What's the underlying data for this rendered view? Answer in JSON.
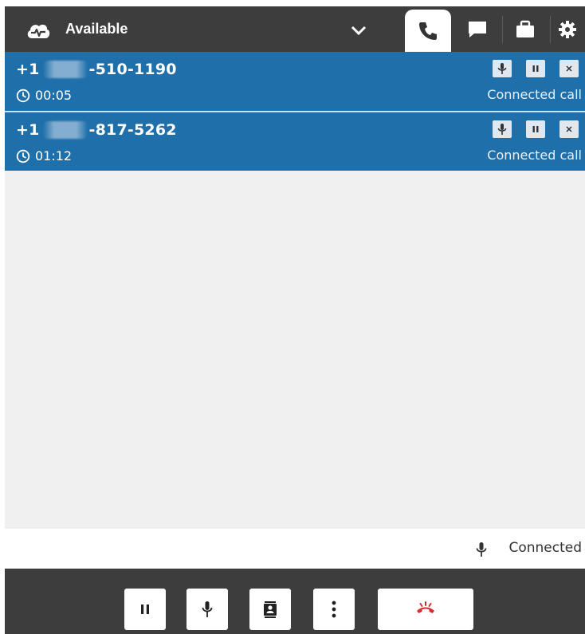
{
  "header": {
    "status_label": "Available",
    "icons": [
      "cloud-status-icon",
      "chevron-down-icon",
      "phone-icon",
      "chat-icon",
      "briefcase-icon",
      "gear-icon"
    ]
  },
  "calls": [
    {
      "prefix": "+1",
      "suffix": "-510-1190",
      "duration": "00:05",
      "state": "Connected call"
    },
    {
      "prefix": "+1",
      "suffix": "-817-5262",
      "duration": "01:12",
      "state": "Connected call"
    }
  ],
  "status_strip": {
    "text": "Connected"
  },
  "colors": {
    "topbar": "#3d3d3d",
    "call_row": "#1f6fab",
    "end_call": "#d92b2b",
    "background": "#f0f0f0"
  }
}
